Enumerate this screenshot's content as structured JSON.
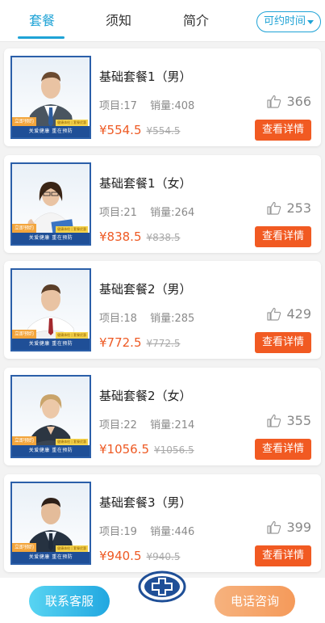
{
  "tabs": {
    "items": [
      {
        "label": "套餐",
        "active": true
      },
      {
        "label": "须知",
        "active": false
      },
      {
        "label": "简介",
        "active": false
      }
    ],
    "available_time_label": "可约时间"
  },
  "thumb": {
    "book_tag": "立即预约",
    "small_tag": "健康体检 | 套餐优惠",
    "footer_text": "关爱健康  重在预防"
  },
  "packages": [
    {
      "title": "基础套餐1（男）",
      "items_label": "项目:17",
      "sales_label": "销量:408",
      "likes": "366",
      "price": "¥554.5",
      "old_price": "¥554.5",
      "detail_label": "查看详情",
      "person": "male-suit"
    },
    {
      "title": "基础套餐1（女）",
      "items_label": "项目:21",
      "sales_label": "销量:264",
      "likes": "253",
      "price": "¥838.5",
      "old_price": "¥838.5",
      "detail_label": "查看详情",
      "person": "female-thumbs"
    },
    {
      "title": "基础套餐2（男）",
      "items_label": "项目:18",
      "sales_label": "销量:285",
      "likes": "429",
      "price": "¥772.5",
      "old_price": "¥772.5",
      "detail_label": "查看详情",
      "person": "male-shirt"
    },
    {
      "title": "基础套餐2（女）",
      "items_label": "项目:22",
      "sales_label": "销量:214",
      "likes": "355",
      "price": "¥1056.5",
      "old_price": "¥1056.5",
      "detail_label": "查看详情",
      "person": "female-suit"
    },
    {
      "title": "基础套餐3（男）",
      "items_label": "项目:19",
      "sales_label": "销量:446",
      "likes": "399",
      "price": "¥940.5",
      "old_price": "¥940.5",
      "detail_label": "查看详情",
      "person": "male-dark"
    }
  ],
  "bottom": {
    "contact_label": "联系客服",
    "phone_label": "电话咨询",
    "logo_icon": "medical-cross-logo"
  },
  "colors": {
    "accent": "#1fa3d6",
    "price": "#ee5a24",
    "detail_button": "#f15a22",
    "thumb_border": "#2b5fa9"
  }
}
